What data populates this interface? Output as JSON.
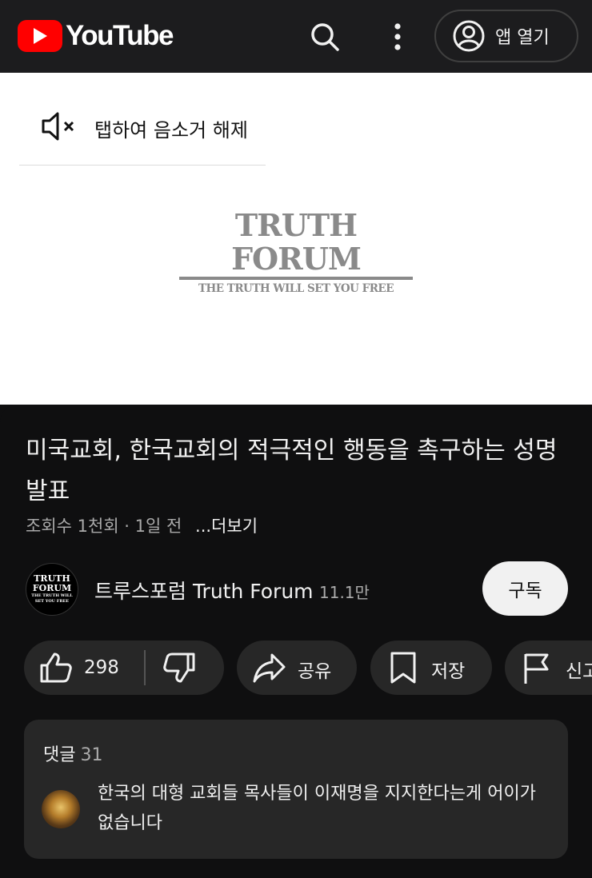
{
  "header": {
    "brand": "YouTube",
    "open_app_label": "앱 열기",
    "icons": [
      "youtube-logo-icon",
      "search-icon",
      "more-vert-icon",
      "account-icon"
    ]
  },
  "player": {
    "unmute_label": "탭하여 음소거 해제",
    "logo_main": "TRUTH FORUM",
    "logo_sub": "THE TRUTH WILL SET YOU FREE"
  },
  "video": {
    "title": "미국교회, 한국교회의 적극적인 행동을 촉구하는 성명 발표",
    "meta": "조회수 1천회 · 1일 전",
    "more_label": "...더보기"
  },
  "channel": {
    "name": "트루스포럼 Truth Forum",
    "subscribers": "11.1만",
    "subscribe_label": "구독",
    "avatar_line1": "TRUTH",
    "avatar_line2": "FORUM",
    "avatar_line3": "THE TRUTH WILL",
    "avatar_line4": "SET YOU FREE"
  },
  "actions": {
    "like_count": "298",
    "share_label": "공유",
    "save_label": "저장",
    "report_label": "신고"
  },
  "comments": {
    "label": "댓글",
    "count": "31",
    "top_comment": "한국의 대형 교회들 목사들이 이재명을 지지한다는게 어이가 없습니다"
  },
  "colors": {
    "brand_red": "#ff0000",
    "background": "#0f0f10",
    "header_bg": "#1c1c1e",
    "pill_bg": "#272727"
  }
}
